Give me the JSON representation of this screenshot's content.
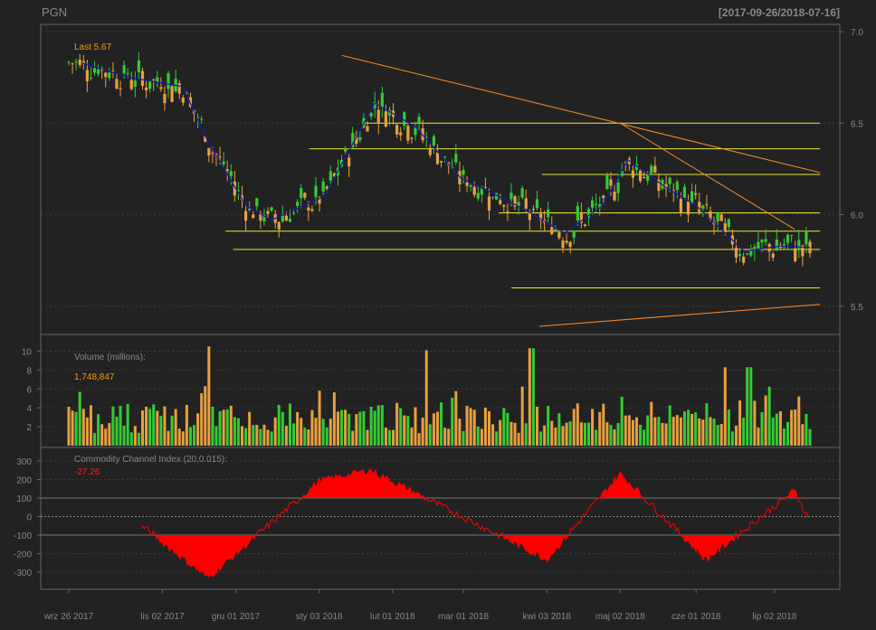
{
  "header": {
    "symbol": "PGN",
    "date_range": "[2017-09-26/2018-07-16]"
  },
  "price_panel": {
    "last_label": "Last 5.67",
    "axis_ticks": [
      "7.0",
      "6.5",
      "6.0",
      "5.5"
    ]
  },
  "volume_panel": {
    "title": "Volume (millions):",
    "last_value": "1,748,847",
    "axis_ticks": [
      "10",
      "8",
      "6",
      "4",
      "2"
    ]
  },
  "cci_panel": {
    "title": "Commodity Channel Index (20,0.015):",
    "last_value": "-27.26",
    "axis_ticks": [
      "300",
      "200",
      "100",
      "0",
      "-100",
      "-200",
      "-300"
    ]
  },
  "x_axis": {
    "ticks": [
      "wrz 26 2017",
      "lis 02 2017",
      "gru 01 2017",
      "sty 03 2018",
      "lut 01 2018",
      "mar 01 2018",
      "kwi 03 2018",
      "maj 02 2018",
      "cze 01 2018",
      "lip 02 2018"
    ]
  },
  "colors": {
    "up": "#33cc33",
    "down": "#e8a040",
    "ma": "#1a1aaa",
    "hline": "#e8e830",
    "trend": "#ff8c28",
    "cci": "#ff0000",
    "text": "#888888",
    "last": "#ff9900"
  },
  "chart_data": [
    {
      "type": "candlestick",
      "title": "PGN",
      "date_range": "2017-09-26/2018-07-16",
      "ylim": [
        5.4,
        7.0
      ],
      "last": 5.67,
      "moving_average_anchors": [
        {
          "date": "2017-10-01",
          "value": 6.83
        },
        {
          "date": "2017-10-20",
          "value": 6.75
        },
        {
          "date": "2017-11-10",
          "value": 6.7
        },
        {
          "date": "2017-11-20",
          "value": 6.4
        },
        {
          "date": "2017-12-05",
          "value": 6.05
        },
        {
          "date": "2017-12-15",
          "value": 5.97
        },
        {
          "date": "2018-01-05",
          "value": 6.1
        },
        {
          "date": "2018-01-25",
          "value": 6.61
        },
        {
          "date": "2018-02-10",
          "value": 6.48
        },
        {
          "date": "2018-02-28",
          "value": 6.2
        },
        {
          "date": "2018-03-15",
          "value": 6.1
        },
        {
          "date": "2018-03-25",
          "value": 6.03
        },
        {
          "date": "2018-04-10",
          "value": 5.9
        },
        {
          "date": "2018-04-25",
          "value": 6.05
        },
        {
          "date": "2018-05-05",
          "value": 6.3
        },
        {
          "date": "2018-05-20",
          "value": 6.15
        },
        {
          "date": "2018-06-01",
          "value": 6.05
        },
        {
          "date": "2018-06-20",
          "value": 5.8
        },
        {
          "date": "2018-07-05",
          "value": 5.83
        },
        {
          "date": "2018-07-16",
          "value": 5.82
        }
      ],
      "horizontal_levels": [
        {
          "value": 6.5,
          "from": "2018-01-20",
          "to": "2018-07-20"
        },
        {
          "value": 6.36,
          "from": "2017-12-30",
          "to": "2018-07-20"
        },
        {
          "value": 6.22,
          "from": "2018-04-01",
          "to": "2018-07-20"
        },
        {
          "value": 6.01,
          "from": "2018-03-15",
          "to": "2018-07-20"
        },
        {
          "value": 5.91,
          "from": "2017-11-27",
          "to": "2018-07-20"
        },
        {
          "value": 5.81,
          "from": "2017-11-30",
          "to": "2018-07-20"
        },
        {
          "value": 5.6,
          "from": "2018-03-20",
          "to": "2018-07-20"
        }
      ],
      "trend_lines": [
        {
          "from": {
            "date": "2018-01-12",
            "value": 6.87
          },
          "to": {
            "date": "2018-07-20",
            "value": 6.23
          }
        },
        {
          "from": {
            "date": "2018-05-02",
            "value": 6.5
          },
          "to": {
            "date": "2018-07-10",
            "value": 5.92
          }
        },
        {
          "from": {
            "date": "2018-03-31",
            "value": 5.39
          },
          "to": {
            "date": "2018-07-20",
            "value": 5.51
          }
        }
      ]
    },
    {
      "type": "bar",
      "title": "Volume (millions):",
      "ylim": [
        0,
        11
      ],
      "last": 1.748847,
      "notable_values": [
        {
          "date": "2017-11-20",
          "value": 10.5
        },
        {
          "date": "2018-02-15",
          "value": 10.1
        },
        {
          "date": "2018-03-28",
          "value": 10.3
        },
        {
          "date": "2018-06-12",
          "value": 8.3
        },
        {
          "date": "2018-06-22",
          "value": 8.3
        },
        {
          "date": "2018-07-12",
          "value": 5.2
        }
      ]
    },
    {
      "type": "area",
      "title": "Commodity Channel Index (20,0.015):",
      "ylim": [
        -300,
        300
      ],
      "reference_lines": [
        100,
        0,
        -100
      ],
      "last": -27.26,
      "extremes": [
        {
          "date": "2017-11-20",
          "value": -330
        },
        {
          "date": "2018-01-03",
          "value": 190
        },
        {
          "date": "2018-01-23",
          "value": 250
        },
        {
          "date": "2018-04-03",
          "value": -230
        },
        {
          "date": "2018-05-02",
          "value": 230
        },
        {
          "date": "2018-06-05",
          "value": -230
        },
        {
          "date": "2018-07-10",
          "value": 140
        }
      ]
    }
  ]
}
